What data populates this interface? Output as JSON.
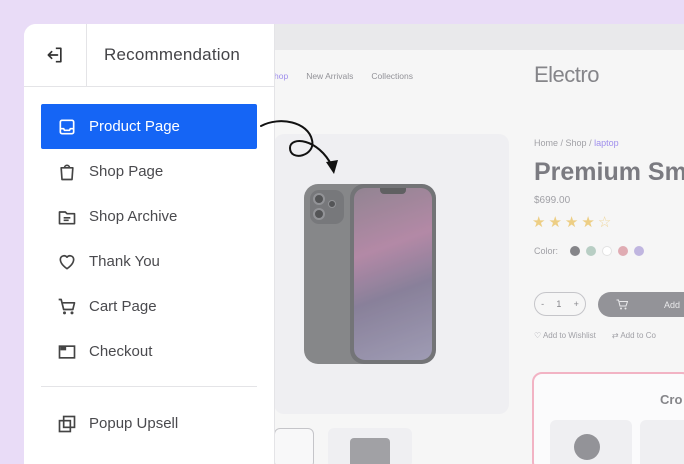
{
  "sidebar": {
    "title": "Recommendation",
    "items": [
      {
        "label": "Product Page",
        "icon": "inbox-tray-icon",
        "active": true
      },
      {
        "label": "Shop Page",
        "icon": "shopping-bag-icon",
        "active": false
      },
      {
        "label": "Shop Archive",
        "icon": "folder-icon",
        "active": false
      },
      {
        "label": "Thank You",
        "icon": "heart-icon",
        "active": false
      },
      {
        "label": "Cart Page",
        "icon": "cart-icon",
        "active": false
      },
      {
        "label": "Checkout",
        "icon": "checkout-window-icon",
        "active": false
      }
    ],
    "extra_item": {
      "label": "Popup Upsell",
      "icon": "popup-layers-icon"
    }
  },
  "preview": {
    "nav": [
      "hop",
      "New Arrivals",
      "Collections"
    ],
    "logo": "Electro",
    "breadcrumb": {
      "home": "Home",
      "sep1": " / ",
      "shop": "Shop",
      "sep2": " / ",
      "current": "laptop"
    },
    "product_title": "Premium Sma",
    "price": "$699.00",
    "rating": 4,
    "rating_max": 5,
    "color_label": "Color:",
    "swatches": [
      "#6b6b6f",
      "#a9c4b8",
      "#ffffff",
      "#d99aa3",
      "#b3a6d9"
    ],
    "qty": {
      "minus": "-",
      "value": "1",
      "plus": "+"
    },
    "add_label": "Add",
    "wishlist": "Add to Wishlist",
    "compare": "Add to Co",
    "cross_title": "Cro"
  },
  "colors": {
    "accent": "#1565f5",
    "frame_bg": "#e9dcf7"
  }
}
